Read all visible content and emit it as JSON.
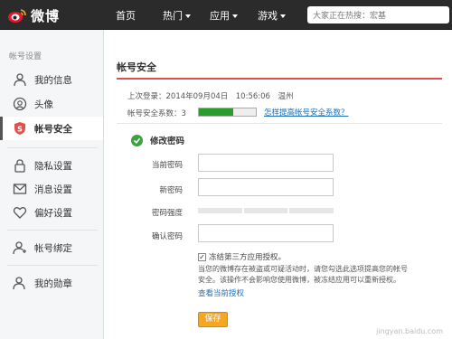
{
  "header": {
    "logo_text": "微博",
    "nav": [
      {
        "label": "首页",
        "has_caret": false
      },
      {
        "label": "热门",
        "has_caret": true
      },
      {
        "label": "应用",
        "has_caret": true
      },
      {
        "label": "游戏",
        "has_caret": true
      }
    ],
    "search_placeholder": "大家正在热搜：宏基"
  },
  "sidebar": {
    "section_title": "帐号设置",
    "items": [
      {
        "label": "我的信息",
        "icon": "user-icon"
      },
      {
        "label": "头像",
        "icon": "avatar-icon"
      },
      {
        "label": "帐号安全",
        "icon": "shield-icon",
        "active": true
      },
      {
        "label": "隐私设置",
        "icon": "lock-icon"
      },
      {
        "label": "消息设置",
        "icon": "message-icon"
      },
      {
        "label": "偏好设置",
        "icon": "heart-icon"
      },
      {
        "label": "帐号绑定",
        "icon": "person-link-icon"
      },
      {
        "label": "我的勋章",
        "icon": "medal-icon"
      }
    ]
  },
  "main": {
    "title": "帐号安全",
    "last_login": "上次登录：2014年09月04日　10:56:06　温州",
    "security_label": "帐号安全系数：3",
    "security_level": 0.6,
    "help_link": "怎样提高帐号安全系数？",
    "section_title": "修改密码",
    "labels": {
      "current": "当前密码",
      "new": "新密码",
      "strength": "密码强度",
      "confirm": "确认密码"
    },
    "checkbox_label": "冻结第三方应用授权。",
    "note_line1": "当您的微博存在被盗或可疑活动时，请您勾选此选项提高您的帐号",
    "note_line2": "安全。该操作不会影响您使用微博，被冻结应用可以重新授权。",
    "view_link": "查看当前授权",
    "save_label": "保存"
  },
  "watermark": "jingyan.baidu.com",
  "colors": {
    "accent": "#e2504d",
    "save": "#f5a623",
    "link": "#1b6fb7",
    "meter": "#2a9c2d"
  }
}
